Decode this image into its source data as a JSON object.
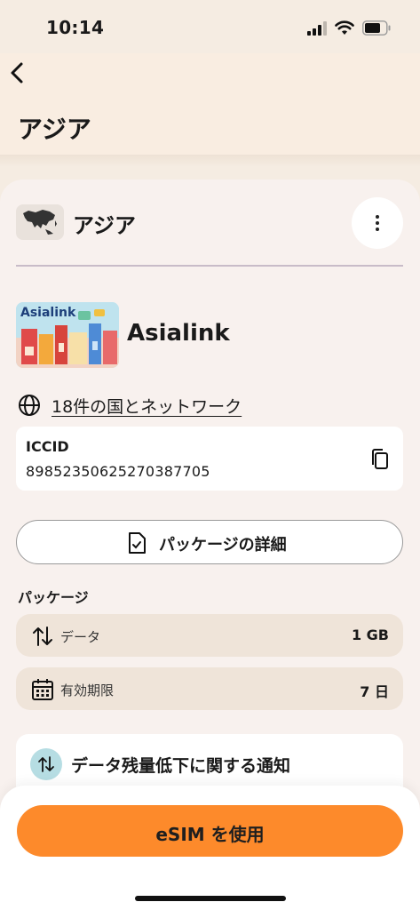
{
  "status_bar": {
    "time": "10:14"
  },
  "header": {
    "title": "アジア"
  },
  "region": {
    "name": "アジア"
  },
  "provider": {
    "name": "Asialink",
    "image_label": "Asialink"
  },
  "countries": {
    "link_text": "18件の国とネットワーク"
  },
  "iccid": {
    "label": "ICCID",
    "value": "89852350625270387705"
  },
  "details_button": {
    "label": "パッケージの詳細"
  },
  "package": {
    "heading": "パッケージ",
    "items": [
      {
        "label": "データ",
        "value": "1 GB",
        "icon": "data-transfer-icon"
      },
      {
        "label": "有効期限",
        "value": "7 日",
        "icon": "calendar-icon"
      }
    ]
  },
  "alert": {
    "title": "データ残量低下に関する通知",
    "icon": "data-transfer-icon"
  },
  "cta": {
    "label": "eSIM を使用"
  },
  "colors": {
    "accent": "#fd8a2b",
    "background": "#f5ece2",
    "card": "#f8f1ee",
    "row": "#efe4d9",
    "alert_icon_bg": "#b6dde3"
  }
}
